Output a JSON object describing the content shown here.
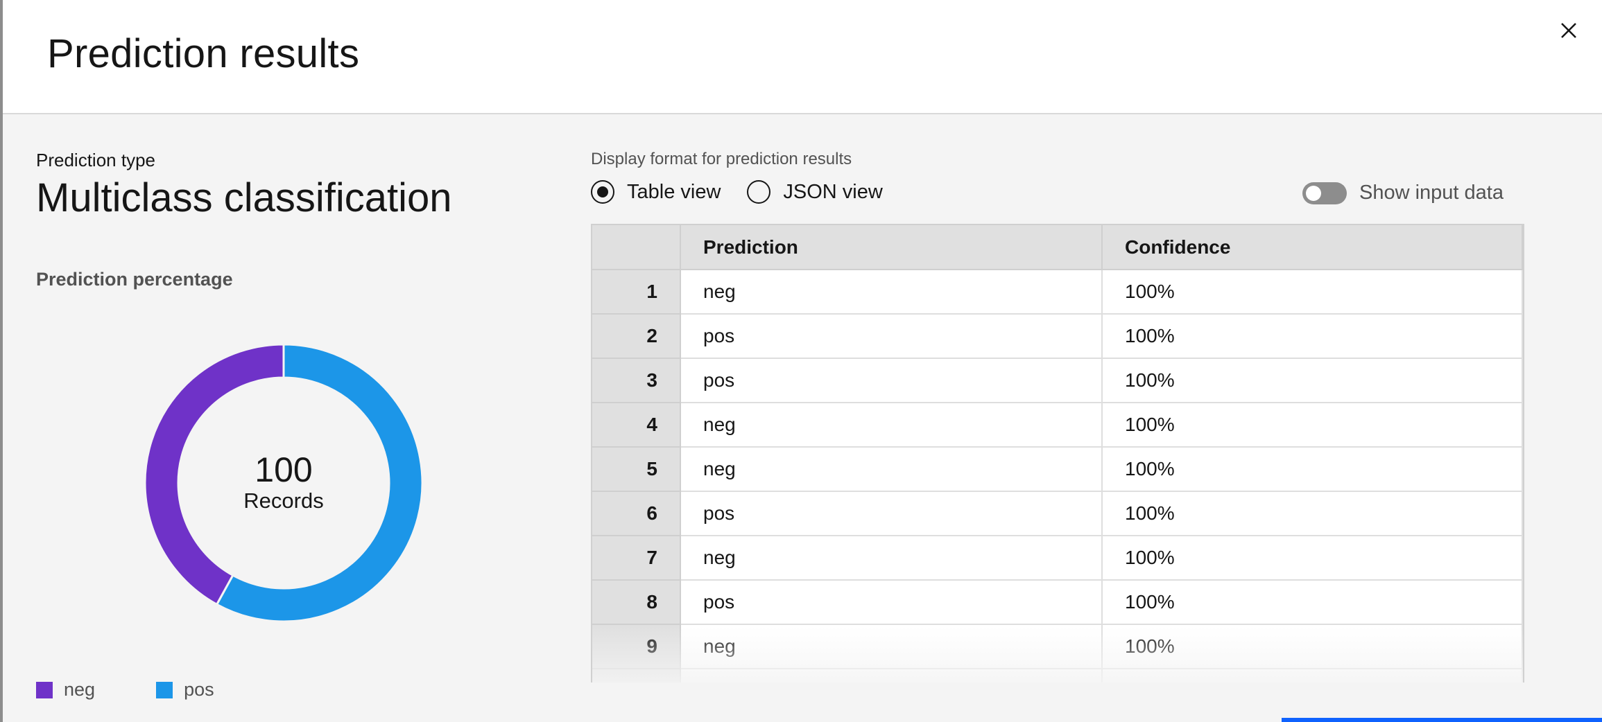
{
  "modal": {
    "title": "Prediction results"
  },
  "prediction": {
    "type_label": "Prediction type",
    "type_value": "Multiclass classification",
    "percentage_label": "Prediction percentage",
    "total_count": "100",
    "total_label": "Records"
  },
  "chart_data": {
    "type": "pie",
    "categories": [
      "neg",
      "pos"
    ],
    "values": [
      42,
      58
    ],
    "colors": [
      "#6f32c8",
      "#1c96e8"
    ],
    "title": "",
    "legend": "bottom-left"
  },
  "legend": {
    "items": [
      {
        "label": "neg",
        "color": "#6f32c8"
      },
      {
        "label": "pos",
        "color": "#1c96e8"
      }
    ]
  },
  "display": {
    "label": "Display format for prediction results",
    "options": [
      {
        "label": "Table view",
        "selected": true
      },
      {
        "label": "JSON view",
        "selected": false
      }
    ],
    "toggle_label": "Show input data"
  },
  "table": {
    "headers": [
      "",
      "Prediction",
      "Confidence"
    ],
    "rows": [
      {
        "index": "1",
        "prediction": "neg",
        "confidence": "100%"
      },
      {
        "index": "2",
        "prediction": "pos",
        "confidence": "100%"
      },
      {
        "index": "3",
        "prediction": "pos",
        "confidence": "100%"
      },
      {
        "index": "4",
        "prediction": "neg",
        "confidence": "100%"
      },
      {
        "index": "5",
        "prediction": "neg",
        "confidence": "100%"
      },
      {
        "index": "6",
        "prediction": "pos",
        "confidence": "100%"
      },
      {
        "index": "7",
        "prediction": "neg",
        "confidence": "100%"
      },
      {
        "index": "8",
        "prediction": "pos",
        "confidence": "100%"
      },
      {
        "index": "9",
        "prediction": "neg",
        "confidence": "100%"
      }
    ]
  }
}
